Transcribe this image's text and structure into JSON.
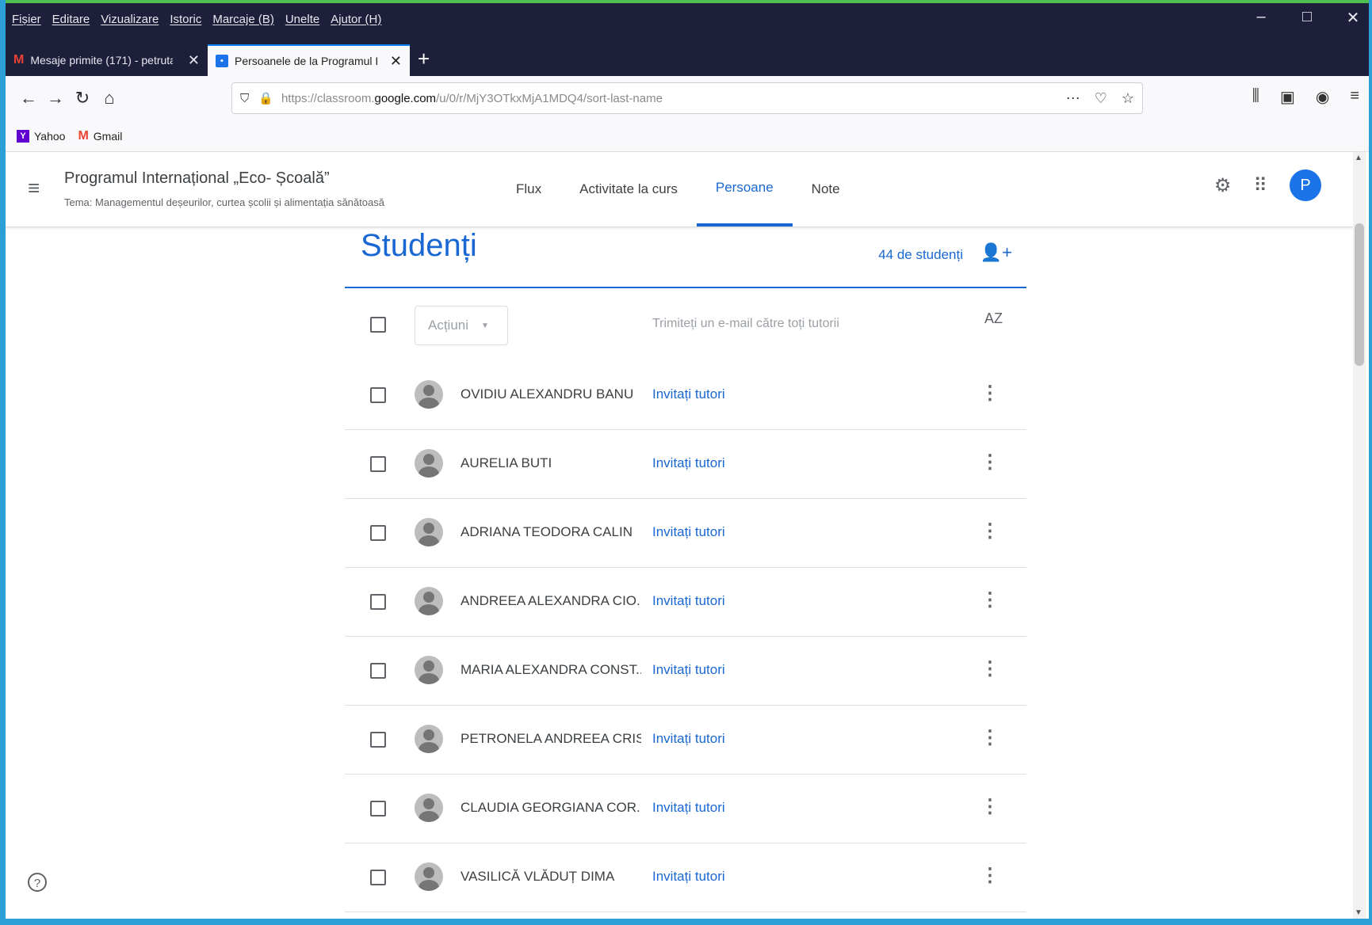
{
  "menubar": [
    "Fișier",
    "Editare",
    "Vizualizare",
    "Istoric",
    "Marcaje (B)",
    "Unelte",
    "Ajutor (H)"
  ],
  "window_controls": {
    "minimize": "–",
    "maximize": "□",
    "close": "✕"
  },
  "tabs": [
    {
      "title": "Mesaje primite (171) - petruta",
      "icon": "gmail-icon",
      "active": false
    },
    {
      "title": "Persoanele de la Programul Int",
      "icon": "classroom-icon",
      "active": true
    }
  ],
  "new_tab_label": "+",
  "url": {
    "prefix": "https://classroom.",
    "domain": "google.com",
    "path": "/u/0/r/MjY3OTkxMjA1MDQ4/sort-last-name"
  },
  "bookmarks": [
    {
      "label": "Yahoo",
      "icon": "yahoo-icon"
    },
    {
      "label": "Gmail",
      "icon": "gmail-icon"
    }
  ],
  "course": {
    "title": "Programul Internațional „Eco- Școală”",
    "subtitle": "Tema: Managementul deșeurilor, curtea școlii și alimentația sănătoasă"
  },
  "course_nav": [
    "Flux",
    "Activitate la curs",
    "Persoane",
    "Note"
  ],
  "course_nav_active": "Persoane",
  "avatar_letter": "P",
  "students": {
    "title": "Studenți",
    "count": "44 de studenți",
    "actions_label": "Acțiuni",
    "email_all": "Trimiteți un e-mail către toți tutorii",
    "sort_label": "AZ",
    "invite_label": "Invitați tutori",
    "list": [
      "OVIDIU ALEXANDRU BANU",
      "AURELIA BUTI",
      "ADRIANA TEODORA CALIN",
      "ANDREEA ALEXANDRA CIO...",
      "MARIA ALEXANDRA CONST...",
      "PETRONELA ANDREEA CRIS...",
      "CLAUDIA GEORGIANA COR...",
      "VASILICĂ VLĂDUȚ DIMA"
    ]
  },
  "help_label": "?",
  "colors": {
    "accent": "#1967d2",
    "titlebar": "#1e1f3b",
    "frame": "#2ca0d6"
  }
}
